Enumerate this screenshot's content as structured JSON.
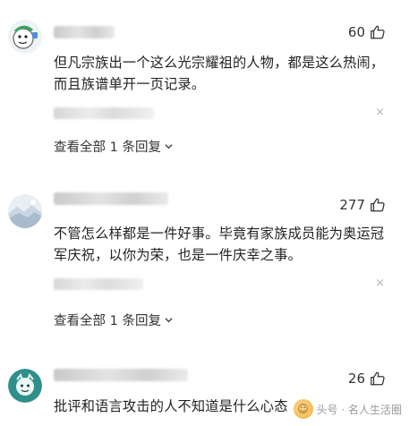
{
  "comments": [
    {
      "likes": "60",
      "text": "但凡宗族出一个这么光宗耀祖的人物，都是这么热闹，而且族谱单开一页记录。",
      "view_replies": "查看全部 1 条回复",
      "reply_close": "×",
      "avatar_icon": "cartoon-face-avatar"
    },
    {
      "likes": "277",
      "text": "不管怎么样都是一件好事。毕竟有家族成员能为奥运冠军庆祝，以你为荣，也是一件庆幸之事。",
      "view_replies": "查看全部 1 条回复",
      "reply_close": "×",
      "avatar_icon": "landscape-avatar"
    },
    {
      "likes": "26",
      "text": "批评和语言攻击的人不知道是什么心态",
      "avatar_icon": "green-character-avatar"
    }
  ],
  "watermark": {
    "text": "头号 · 名人生活圈"
  },
  "colors": {
    "text": "#222222",
    "muted": "#b5b5b5"
  }
}
